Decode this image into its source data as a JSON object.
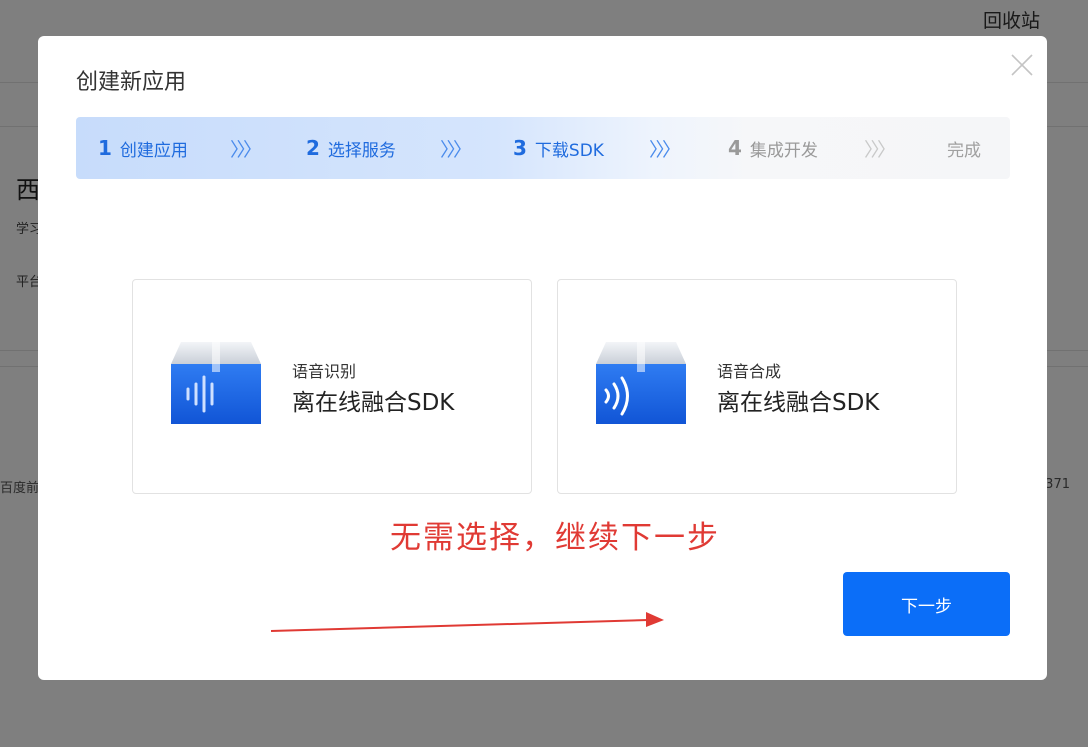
{
  "background": {
    "recycle_bin": "回收站",
    "title_fragment": "西",
    "sub1_fragment": "学习",
    "sub2_fragment": "平台",
    "footer_left_fragment": "百度前",
    "footer_right_fragment": "371"
  },
  "modal": {
    "title": "创建新应用",
    "close_icon": "close-icon"
  },
  "stepper": {
    "steps": [
      {
        "num": "1",
        "label": "创建应用",
        "state": "active"
      },
      {
        "num": "2",
        "label": "选择服务",
        "state": "active"
      },
      {
        "num": "3",
        "label": "下载SDK",
        "state": "active"
      },
      {
        "num": "4",
        "label": "集成开发",
        "state": "inactive"
      }
    ],
    "final": "完成",
    "separator": "〉〉〉"
  },
  "cards": [
    {
      "label": "语音识别",
      "name": "离在线融合SDK",
      "icon": "speech-recognition-icon"
    },
    {
      "label": "语音合成",
      "name": "离在线融合SDK",
      "icon": "speech-synthesis-icon"
    }
  ],
  "annotation": {
    "note": "无需选择，继续下一步"
  },
  "next_button": {
    "label": "下一步"
  },
  "colors": {
    "primary": "#0b6ef8",
    "step_active": "#1f6bde",
    "annotation_red": "#e03a34"
  }
}
